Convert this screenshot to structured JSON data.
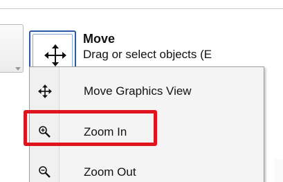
{
  "toolbar": {
    "active_tool": {
      "title": "Move",
      "description": "Drag or select objects (E",
      "icon": "move-arrows-icon",
      "accent": "#3058a8"
    }
  },
  "dropdown": {
    "items": [
      {
        "label": "Move Graphics View",
        "icon": "move-arrows-icon"
      },
      {
        "label": "Zoom In",
        "icon": "zoom-in-icon"
      },
      {
        "label": "Zoom Out",
        "icon": "zoom-out-icon"
      }
    ],
    "highlighted_item": "Zoom In",
    "highlight_color": "#e0141c"
  }
}
